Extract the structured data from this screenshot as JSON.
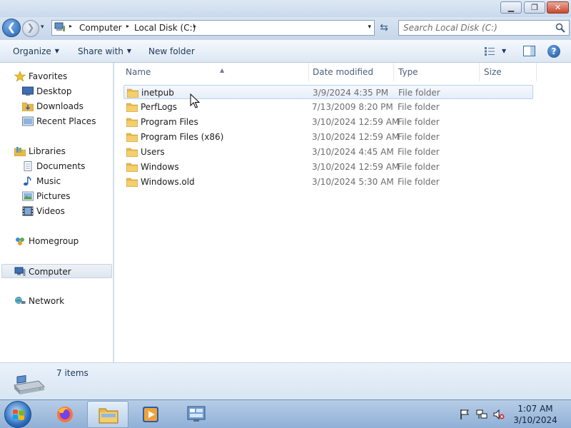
{
  "window": {
    "minimize_glyph": "▁",
    "restore_glyph": "❐",
    "close_glyph": "✕"
  },
  "nav": {
    "back_glyph": "❮",
    "forward_glyph": "❯",
    "history_glyph": "▾",
    "breadcrumb": [
      "Computer",
      "Local Disk (C:)"
    ],
    "separator_glyph": "▸",
    "address_dropdown_glyph": "▾",
    "refresh_glyph": "⇆",
    "search_placeholder": "Search Local Disk (C:)"
  },
  "toolbar": {
    "organize_label": "Organize",
    "share_label": "Share with",
    "new_folder_label": "New folder",
    "dropdown_glyph": "▼",
    "help_glyph": "?"
  },
  "sidebar": {
    "favorites": {
      "label": "Favorites",
      "items": [
        {
          "label": "Desktop",
          "icon": "desktop-icon"
        },
        {
          "label": "Downloads",
          "icon": "downloads-icon"
        },
        {
          "label": "Recent Places",
          "icon": "recent-places-icon"
        }
      ]
    },
    "libraries": {
      "label": "Libraries",
      "items": [
        {
          "label": "Documents",
          "icon": "documents-icon"
        },
        {
          "label": "Music",
          "icon": "music-icon"
        },
        {
          "label": "Pictures",
          "icon": "pictures-icon"
        },
        {
          "label": "Videos",
          "icon": "videos-icon"
        }
      ]
    },
    "homegroup": {
      "label": "Homegroup"
    },
    "computer": {
      "label": "Computer",
      "selected": true
    },
    "network": {
      "label": "Network"
    }
  },
  "files": {
    "columns": [
      "Name",
      "Date modified",
      "Type",
      "Size"
    ],
    "sort_glyph": "▲",
    "rows": [
      {
        "name": "inetpub",
        "date": "3/9/2024 4:35 PM",
        "type": "File folder",
        "hovered": true
      },
      {
        "name": "PerfLogs",
        "date": "7/13/2009 8:20 PM",
        "type": "File folder"
      },
      {
        "name": "Program Files",
        "date": "3/10/2024 12:59 AM",
        "type": "File folder"
      },
      {
        "name": "Program Files (x86)",
        "date": "3/10/2024 12:59 AM",
        "type": "File folder"
      },
      {
        "name": "Users",
        "date": "3/10/2024 4:45 AM",
        "type": "File folder"
      },
      {
        "name": "Windows",
        "date": "3/10/2024 12:59 AM",
        "type": "File folder"
      },
      {
        "name": "Windows.old",
        "date": "3/10/2024 5:30 AM",
        "type": "File folder"
      }
    ]
  },
  "details": {
    "item_count": "7 items"
  },
  "taskbar": {
    "pinned": [
      "firefox-icon",
      "explorer-icon",
      "media-player-icon",
      "server-manager-icon"
    ],
    "active": "explorer-icon",
    "tray": [
      "action-center-flag-icon",
      "network-icon",
      "volume-muted-icon"
    ],
    "time": "1:07 AM",
    "date": "3/10/2024"
  },
  "colors": {
    "accent": "#1e395b",
    "folder": "#e8b94a",
    "selection_border": "#b9d1ef"
  }
}
